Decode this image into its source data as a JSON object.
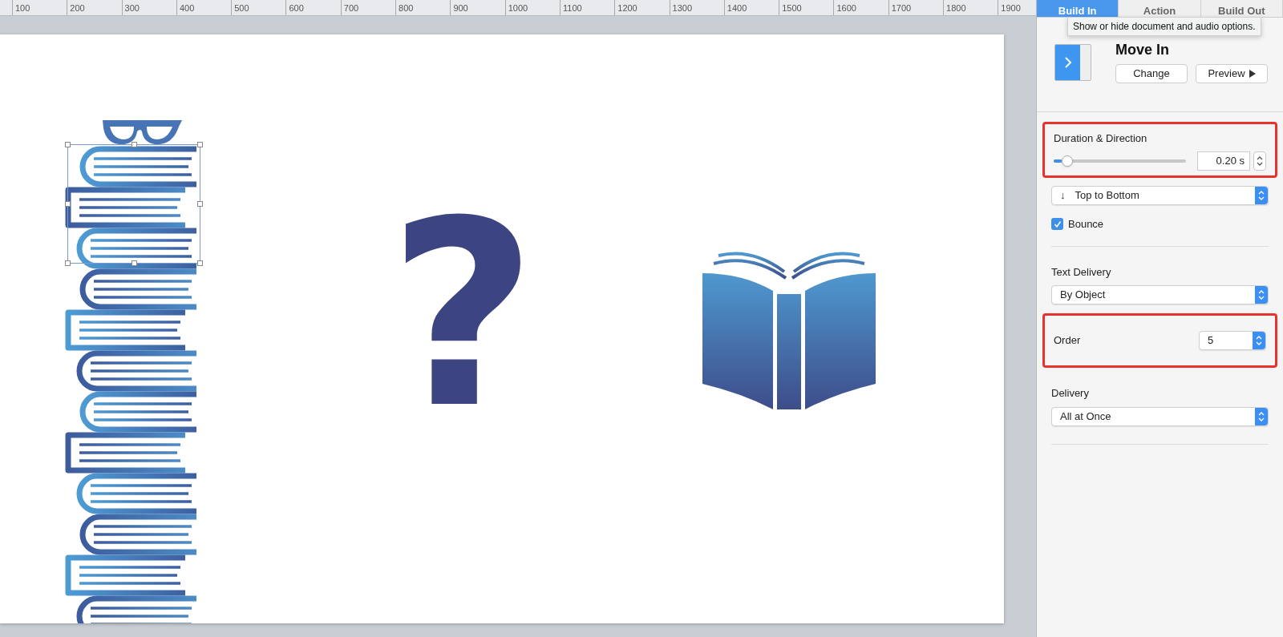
{
  "ruler": {
    "labels": [
      "100",
      "200",
      "300",
      "400",
      "500",
      "600",
      "700",
      "800",
      "900",
      "1000",
      "1100",
      "1200",
      "1300",
      "1400",
      "1500",
      "1600",
      "1700",
      "1800",
      "1900"
    ]
  },
  "slide": {
    "question_mark": "?",
    "selected_object": true
  },
  "panel": {
    "tabs": [
      {
        "label": "Build In",
        "selected": true
      },
      {
        "label": "Action",
        "selected": false
      },
      {
        "label": "Build Out",
        "selected": false
      }
    ],
    "tooltip": "Show or hide document and audio options.",
    "effect": {
      "name": "Move In",
      "buttons": [
        {
          "label": "Change",
          "kind": "plain"
        },
        {
          "label": "Preview",
          "kind": "play"
        }
      ]
    },
    "duration": {
      "title": "Duration & Direction",
      "level": 0.06,
      "value": "0.20 s",
      "highlighted": true
    },
    "direction": {
      "arrow": "↓",
      "value": "Top to Bottom"
    },
    "bounce": {
      "label": "Bounce",
      "checked": true
    },
    "text_delivery": {
      "title": "Text Delivery",
      "value": "By Object"
    },
    "order": {
      "title": "Order",
      "value": "5",
      "highlighted": true
    },
    "delivery": {
      "title": "Delivery",
      "value": "All at Once"
    }
  }
}
